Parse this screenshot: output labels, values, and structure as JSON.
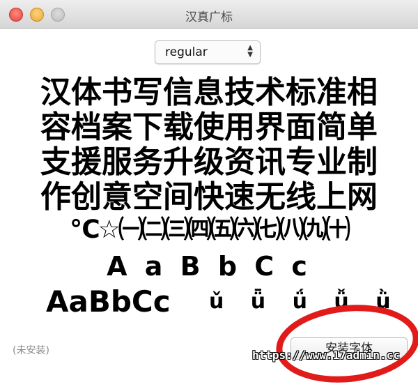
{
  "window": {
    "title": "汉真广标"
  },
  "style_select": {
    "value": "regular"
  },
  "preview": {
    "lines": [
      "汉体书写信息技术标准相",
      "容档案下载使用界面简单",
      "支援服务升级资讯专业制",
      "作创意空间快速无线上网",
      "℃☆㈠㈡㈢㈣㈤㈥㈦㈧㈨㈩",
      "A a B b C c",
      "AaBbCc",
      "ǔ ǖ ǘ ǚ ǜ"
    ]
  },
  "footer": {
    "status": "(未安装)",
    "install_button": "安装字体"
  },
  "watermark": "https://www.17admin.cc"
}
